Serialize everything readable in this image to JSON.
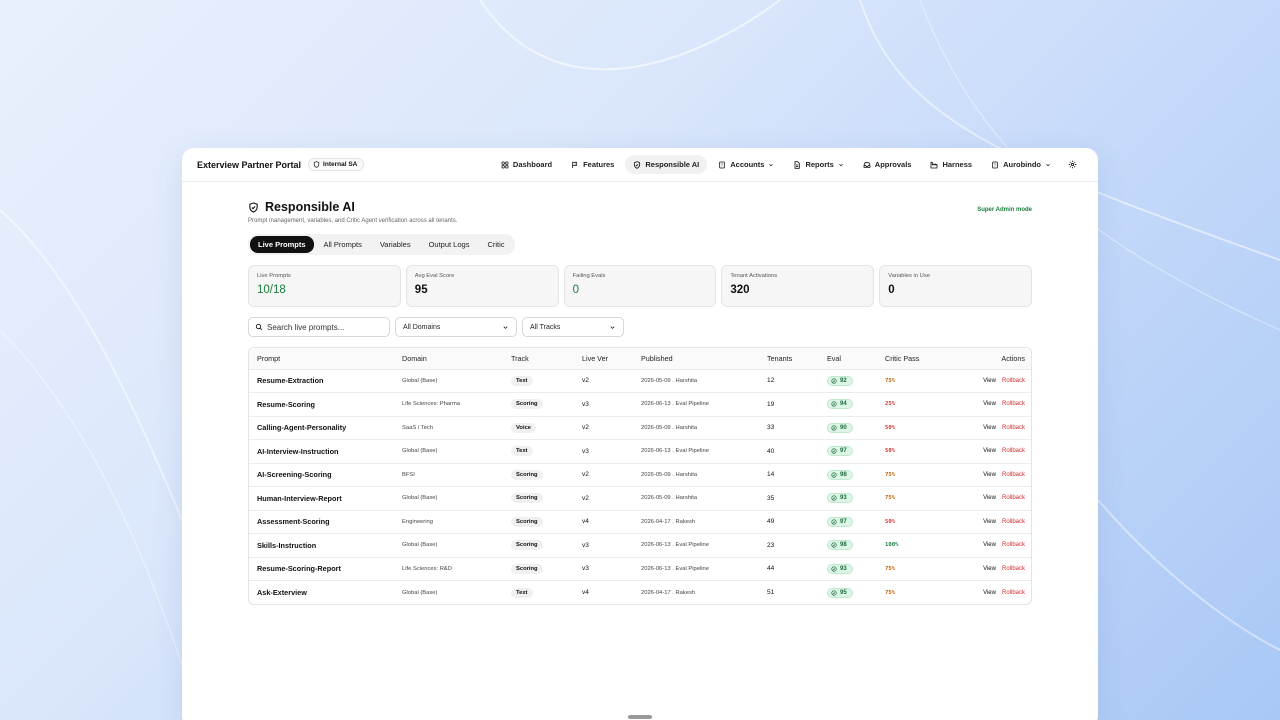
{
  "header": {
    "brand": "Exterview Partner Portal",
    "badge": "Internal SA",
    "nav": [
      {
        "label": "Dashboard",
        "icon": "grid-icon",
        "dropdown": false,
        "active": false
      },
      {
        "label": "Features",
        "icon": "flag-icon",
        "dropdown": false,
        "active": false
      },
      {
        "label": "Responsible AI",
        "icon": "shield-check-icon",
        "dropdown": false,
        "active": true
      },
      {
        "label": "Accounts",
        "icon": "building-icon",
        "dropdown": true,
        "active": false
      },
      {
        "label": "Reports",
        "icon": "document-icon",
        "dropdown": true,
        "active": false
      },
      {
        "label": "Approvals",
        "icon": "inbox-icon",
        "dropdown": false,
        "active": false
      },
      {
        "label": "Harness",
        "icon": "factory-icon",
        "dropdown": false,
        "active": false
      },
      {
        "label": "Aurobindo",
        "icon": "building-icon",
        "dropdown": true,
        "active": false
      }
    ]
  },
  "page": {
    "title": "Responsible AI",
    "subtitle": "Prompt management, variables, and Critic Agent verification across all tenants.",
    "mode": "Super Admin mode"
  },
  "tabs": [
    "Live Prompts",
    "All Prompts",
    "Variables",
    "Output Logs",
    "Critic"
  ],
  "active_tab": "Live Prompts",
  "stats": [
    {
      "label": "Live Prompts",
      "value": "10/18"
    },
    {
      "label": "Avg Eval Score",
      "value": "95"
    },
    {
      "label": "Failing Evals",
      "value": "0"
    },
    {
      "label": "Tenant Activations",
      "value": "320"
    },
    {
      "label": "Variables in Use",
      "value": "0"
    }
  ],
  "filters": {
    "search_placeholder": "Search live prompts...",
    "domain": "All Domains",
    "track": "All Tracks"
  },
  "table": {
    "columns": [
      "Prompt",
      "Domain",
      "Track",
      "Live Ver",
      "Published",
      "Tenants",
      "Eval",
      "Critic Pass",
      "Actions"
    ],
    "view_label": "View",
    "rollback_label": "Rollback",
    "rows": [
      {
        "prompt": "Resume-Extraction",
        "domain": "Global (Base)",
        "track": "Text",
        "ver": "v2",
        "published": "2026-05-09 . Harshita",
        "tenants": "12",
        "eval": "92",
        "critic": "75%"
      },
      {
        "prompt": "Resume-Scoring",
        "domain": "Life Sciences: Pharma",
        "track": "Scoring",
        "ver": "v3",
        "published": "2026-06-13 . Eval Pipeline",
        "tenants": "19",
        "eval": "94",
        "critic": "25%"
      },
      {
        "prompt": "Calling-Agent-Personality",
        "domain": "SaaS / Tech",
        "track": "Voice",
        "ver": "v2",
        "published": "2026-05-09 . Harshita",
        "tenants": "33",
        "eval": "90",
        "critic": "50%"
      },
      {
        "prompt": "AI-Interview-Instruction",
        "domain": "Global (Base)",
        "track": "Text",
        "ver": "v3",
        "published": "2026-06-13 . Eval Pipeline",
        "tenants": "40",
        "eval": "97",
        "critic": "50%"
      },
      {
        "prompt": "AI-Screening-Scoring",
        "domain": "BFSI",
        "track": "Scoring",
        "ver": "v2",
        "published": "2026-05-09 . Harshita",
        "tenants": "14",
        "eval": "98",
        "critic": "75%"
      },
      {
        "prompt": "Human-Interview-Report",
        "domain": "Global (Base)",
        "track": "Scoring",
        "ver": "v2",
        "published": "2026-05-09 . Harshita",
        "tenants": "35",
        "eval": "93",
        "critic": "75%"
      },
      {
        "prompt": "Assessment-Scoring",
        "domain": "Engineering",
        "track": "Scoring",
        "ver": "v4",
        "published": "2026-04-17 . Rakesh",
        "tenants": "49",
        "eval": "97",
        "critic": "50%"
      },
      {
        "prompt": "Skills-Instruction",
        "domain": "Global (Base)",
        "track": "Scoring",
        "ver": "v3",
        "published": "2026-06-13 . Eval Pipeline",
        "tenants": "23",
        "eval": "98",
        "critic": "100%"
      },
      {
        "prompt": "Resume-Scoring-Report",
        "domain": "Life Sciences: R&D",
        "track": "Scoring",
        "ver": "v3",
        "published": "2026-06-13 . Eval Pipeline",
        "tenants": "44",
        "eval": "93",
        "critic": "75%"
      },
      {
        "prompt": "Ask-Exterview",
        "domain": "Global (Base)",
        "track": "Text",
        "ver": "v4",
        "published": "2026-04-17 . Rakesh",
        "tenants": "51",
        "eval": "95",
        "critic": "75%"
      }
    ]
  },
  "colors": {
    "accent_dark": "#111111",
    "success": "#1a7d3d",
    "danger": "#d32f2f",
    "warn": "#c25a00"
  }
}
